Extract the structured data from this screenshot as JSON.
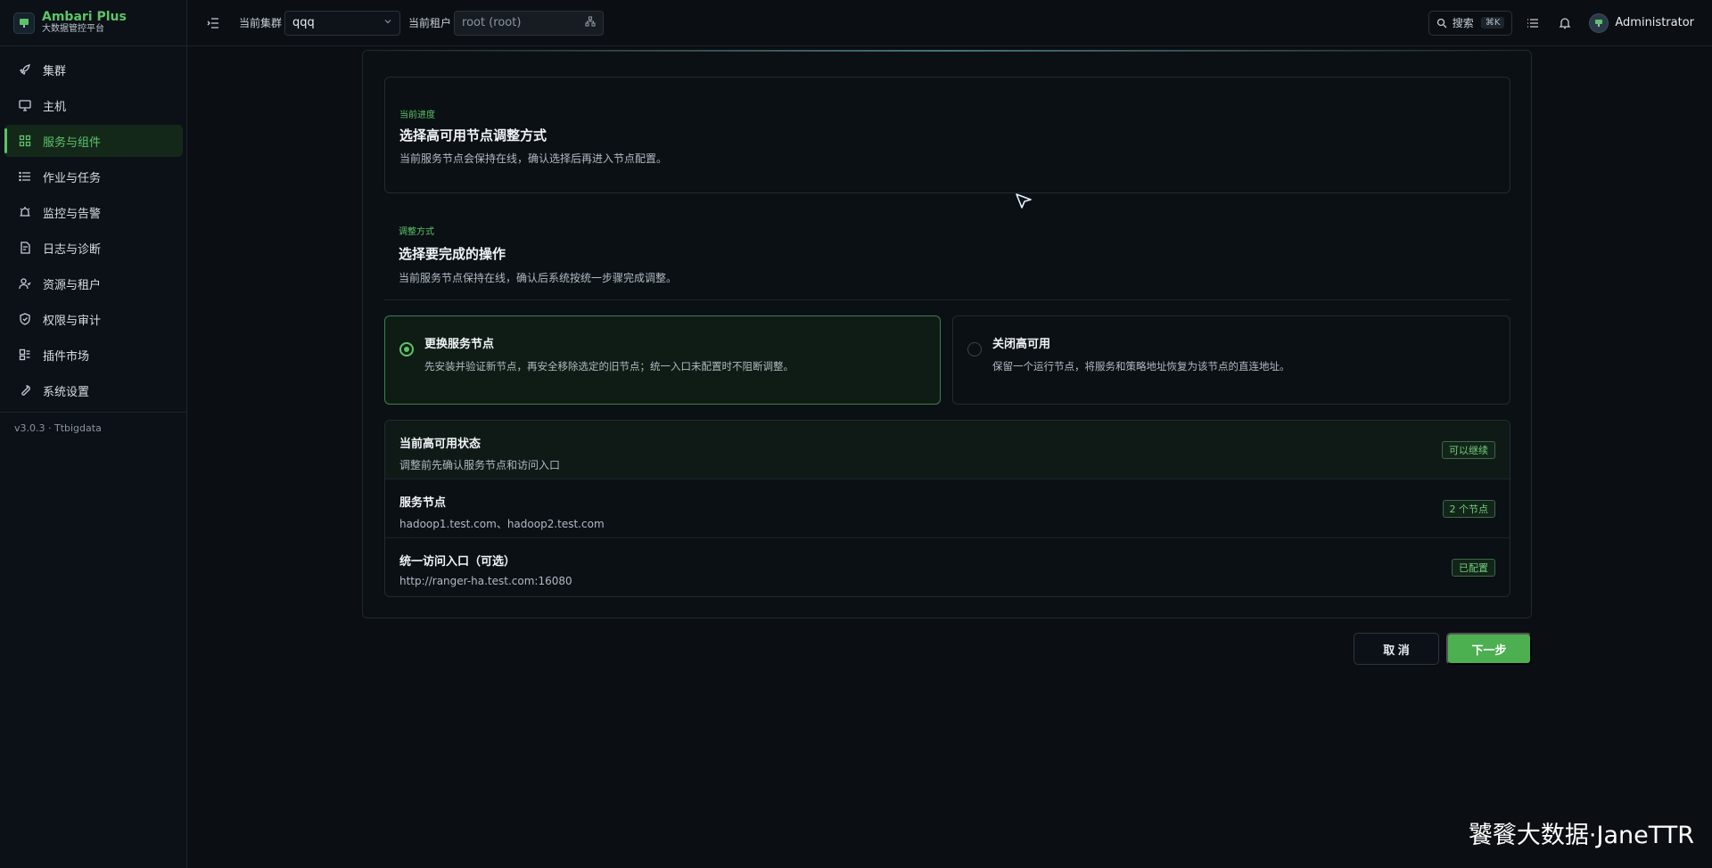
{
  "brand": {
    "title": "Ambari Plus",
    "subtitle": "大数据管控平台"
  },
  "sidebar": {
    "items": [
      {
        "label": "集群",
        "icon": "rocket-icon"
      },
      {
        "label": "主机",
        "icon": "monitor-icon"
      },
      {
        "label": "服务与组件",
        "icon": "grid-icon",
        "active": true
      },
      {
        "label": "作业与任务",
        "icon": "list-icon"
      },
      {
        "label": "监控与告警",
        "icon": "alarm-icon"
      },
      {
        "label": "日志与诊断",
        "icon": "log-icon"
      },
      {
        "label": "资源与租户",
        "icon": "users-icon"
      },
      {
        "label": "权限与审计",
        "icon": "shield-icon"
      },
      {
        "label": "插件市场",
        "icon": "plugin-icon"
      },
      {
        "label": "系统设置",
        "icon": "wrench-icon"
      }
    ],
    "version": "v3.0.3 · Ttbigdata"
  },
  "topbar": {
    "cluster_label": "当前集群",
    "cluster_value": "qqq",
    "tenant_label": "当前租户",
    "tenant_placeholder": "root (root)",
    "search_label": "搜索",
    "search_shortcut": "⌘K",
    "user_name": "Administrator"
  },
  "progress": {
    "eyebrow": "当前进度",
    "title": "选择高可用节点调整方式",
    "desc": "当前服务节点会保持在线，确认选择后再进入节点配置。"
  },
  "mode": {
    "eyebrow": "调整方式",
    "title": "选择要完成的操作",
    "desc": "当前服务节点保持在线，确认后系统按统一步骤完成调整。"
  },
  "options": [
    {
      "title": "更换服务节点",
      "desc": "先安装并验证新节点，再安全移除选定的旧节点；统一入口未配置时不阻断调整。",
      "selected": true
    },
    {
      "title": "关闭高可用",
      "desc": "保留一个运行节点，将服务和策略地址恢复为该节点的直连地址。",
      "selected": false
    }
  ],
  "status": [
    {
      "title": "当前高可用状态",
      "sub": "调整前先确认服务节点和访问入口",
      "badge": "可以继续"
    },
    {
      "title": "服务节点",
      "sub": "hadoop1.test.com、hadoop2.test.com",
      "badge": "2 个节点"
    },
    {
      "title": "统一访问入口（可选）",
      "sub": "http://ranger-ha.test.com:16080",
      "badge": "已配置"
    }
  ],
  "buttons": {
    "cancel": "取 消",
    "next": "下一步"
  },
  "watermark": "饕餮大数据·JaneTTR",
  "colors": {
    "accent": "#5cc468",
    "primary_button": "#4caf50",
    "background": "#0b0f14"
  }
}
